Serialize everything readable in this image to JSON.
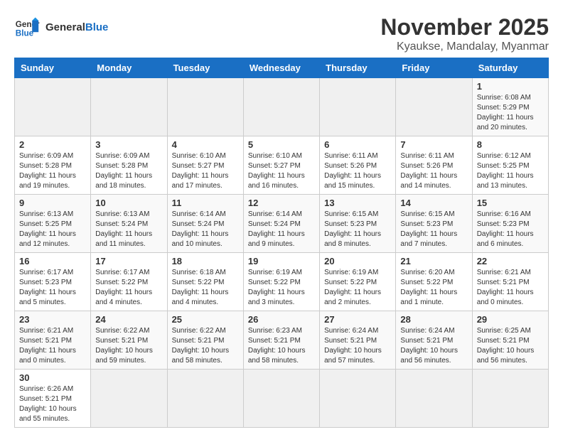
{
  "header": {
    "logo_general": "General",
    "logo_blue": "Blue",
    "title": "November 2025",
    "subtitle": "Kyaukse, Mandalay, Myanmar"
  },
  "days_of_week": [
    "Sunday",
    "Monday",
    "Tuesday",
    "Wednesday",
    "Thursday",
    "Friday",
    "Saturday"
  ],
  "weeks": [
    [
      {
        "day": "",
        "info": ""
      },
      {
        "day": "",
        "info": ""
      },
      {
        "day": "",
        "info": ""
      },
      {
        "day": "",
        "info": ""
      },
      {
        "day": "",
        "info": ""
      },
      {
        "day": "",
        "info": ""
      },
      {
        "day": "1",
        "info": "Sunrise: 6:08 AM\nSunset: 5:29 PM\nDaylight: 11 hours and 20 minutes."
      }
    ],
    [
      {
        "day": "2",
        "info": "Sunrise: 6:09 AM\nSunset: 5:28 PM\nDaylight: 11 hours and 19 minutes."
      },
      {
        "day": "3",
        "info": "Sunrise: 6:09 AM\nSunset: 5:28 PM\nDaylight: 11 hours and 18 minutes."
      },
      {
        "day": "4",
        "info": "Sunrise: 6:10 AM\nSunset: 5:27 PM\nDaylight: 11 hours and 17 minutes."
      },
      {
        "day": "5",
        "info": "Sunrise: 6:10 AM\nSunset: 5:27 PM\nDaylight: 11 hours and 16 minutes."
      },
      {
        "day": "6",
        "info": "Sunrise: 6:11 AM\nSunset: 5:26 PM\nDaylight: 11 hours and 15 minutes."
      },
      {
        "day": "7",
        "info": "Sunrise: 6:11 AM\nSunset: 5:26 PM\nDaylight: 11 hours and 14 minutes."
      },
      {
        "day": "8",
        "info": "Sunrise: 6:12 AM\nSunset: 5:25 PM\nDaylight: 11 hours and 13 minutes."
      }
    ],
    [
      {
        "day": "9",
        "info": "Sunrise: 6:13 AM\nSunset: 5:25 PM\nDaylight: 11 hours and 12 minutes."
      },
      {
        "day": "10",
        "info": "Sunrise: 6:13 AM\nSunset: 5:24 PM\nDaylight: 11 hours and 11 minutes."
      },
      {
        "day": "11",
        "info": "Sunrise: 6:14 AM\nSunset: 5:24 PM\nDaylight: 11 hours and 10 minutes."
      },
      {
        "day": "12",
        "info": "Sunrise: 6:14 AM\nSunset: 5:24 PM\nDaylight: 11 hours and 9 minutes."
      },
      {
        "day": "13",
        "info": "Sunrise: 6:15 AM\nSunset: 5:23 PM\nDaylight: 11 hours and 8 minutes."
      },
      {
        "day": "14",
        "info": "Sunrise: 6:15 AM\nSunset: 5:23 PM\nDaylight: 11 hours and 7 minutes."
      },
      {
        "day": "15",
        "info": "Sunrise: 6:16 AM\nSunset: 5:23 PM\nDaylight: 11 hours and 6 minutes."
      }
    ],
    [
      {
        "day": "16",
        "info": "Sunrise: 6:17 AM\nSunset: 5:23 PM\nDaylight: 11 hours and 5 minutes."
      },
      {
        "day": "17",
        "info": "Sunrise: 6:17 AM\nSunset: 5:22 PM\nDaylight: 11 hours and 4 minutes."
      },
      {
        "day": "18",
        "info": "Sunrise: 6:18 AM\nSunset: 5:22 PM\nDaylight: 11 hours and 4 minutes."
      },
      {
        "day": "19",
        "info": "Sunrise: 6:19 AM\nSunset: 5:22 PM\nDaylight: 11 hours and 3 minutes."
      },
      {
        "day": "20",
        "info": "Sunrise: 6:19 AM\nSunset: 5:22 PM\nDaylight: 11 hours and 2 minutes."
      },
      {
        "day": "21",
        "info": "Sunrise: 6:20 AM\nSunset: 5:22 PM\nDaylight: 11 hours and 1 minute."
      },
      {
        "day": "22",
        "info": "Sunrise: 6:21 AM\nSunset: 5:21 PM\nDaylight: 11 hours and 0 minutes."
      }
    ],
    [
      {
        "day": "23",
        "info": "Sunrise: 6:21 AM\nSunset: 5:21 PM\nDaylight: 11 hours and 0 minutes."
      },
      {
        "day": "24",
        "info": "Sunrise: 6:22 AM\nSunset: 5:21 PM\nDaylight: 10 hours and 59 minutes."
      },
      {
        "day": "25",
        "info": "Sunrise: 6:22 AM\nSunset: 5:21 PM\nDaylight: 10 hours and 58 minutes."
      },
      {
        "day": "26",
        "info": "Sunrise: 6:23 AM\nSunset: 5:21 PM\nDaylight: 10 hours and 58 minutes."
      },
      {
        "day": "27",
        "info": "Sunrise: 6:24 AM\nSunset: 5:21 PM\nDaylight: 10 hours and 57 minutes."
      },
      {
        "day": "28",
        "info": "Sunrise: 6:24 AM\nSunset: 5:21 PM\nDaylight: 10 hours and 56 minutes."
      },
      {
        "day": "29",
        "info": "Sunrise: 6:25 AM\nSunset: 5:21 PM\nDaylight: 10 hours and 56 minutes."
      }
    ],
    [
      {
        "day": "30",
        "info": "Sunrise: 6:26 AM\nSunset: 5:21 PM\nDaylight: 10 hours and 55 minutes."
      },
      {
        "day": "",
        "info": ""
      },
      {
        "day": "",
        "info": ""
      },
      {
        "day": "",
        "info": ""
      },
      {
        "day": "",
        "info": ""
      },
      {
        "day": "",
        "info": ""
      },
      {
        "day": "",
        "info": ""
      }
    ]
  ]
}
